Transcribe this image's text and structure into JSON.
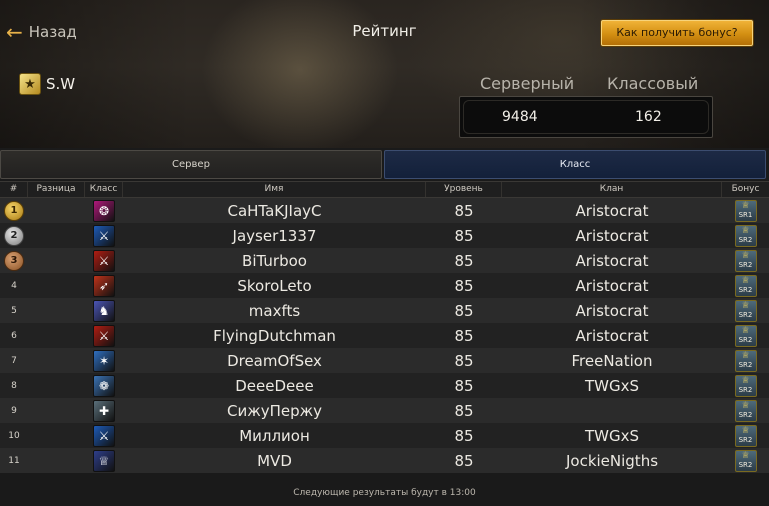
{
  "header": {
    "back_label": "Назад",
    "title": "Рейтинг",
    "bonus_button": "Как получить бонус?"
  },
  "player": {
    "name": "S.W"
  },
  "scores": {
    "server_label": "Серверный",
    "class_label": "Классовый",
    "server_value": "9484",
    "class_value": "162"
  },
  "tabs": {
    "server": "Сервер",
    "class": "Класс",
    "active": "class"
  },
  "table": {
    "headers": {
      "num": "#",
      "diff": "Разница",
      "cls": "Класс",
      "name": "Имя",
      "level": "Уровень",
      "clan": "Клан",
      "bonus": "Бонус"
    },
    "rows": [
      {
        "rank": "1",
        "name": "CaHTaKJIayC",
        "level": "85",
        "clan": "Aristocrat",
        "bonus": "SR1",
        "class_color": "#b0187a",
        "class_icon": "mystic-icon"
      },
      {
        "rank": "2",
        "name": "Jayser1337",
        "level": "85",
        "clan": "Aristocrat",
        "bonus": "SR2",
        "class_color": "#1d5bb8",
        "class_icon": "warrior-blue-icon"
      },
      {
        "rank": "3",
        "name": "BiTurboo",
        "level": "85",
        "clan": "Aristocrat",
        "bonus": "SR2",
        "class_color": "#b11d12",
        "class_icon": "warrior-red-icon"
      },
      {
        "rank": "4",
        "name": "SkoroLeto",
        "level": "85",
        "clan": "Aristocrat",
        "bonus": "SR2",
        "class_color": "#c0331a",
        "class_icon": "archer-icon"
      },
      {
        "rank": "5",
        "name": "maxfts",
        "level": "85",
        "clan": "Aristocrat",
        "bonus": "SR2",
        "class_color": "#4b55b6",
        "class_icon": "knight-icon"
      },
      {
        "rank": "6",
        "name": "FlyingDutchman",
        "level": "85",
        "clan": "Aristocrat",
        "bonus": "SR2",
        "class_color": "#b11d12",
        "class_icon": "warrior-red-icon"
      },
      {
        "rank": "7",
        "name": "DreamOfSex",
        "level": "85",
        "clan": "FreeNation",
        "bonus": "SR2",
        "class_color": "#2f6fc0",
        "class_icon": "rogue-icon"
      },
      {
        "rank": "8",
        "name": "DeeeDeee",
        "level": "85",
        "clan": "TWGxS",
        "bonus": "SR2",
        "class_color": "#3a73b5",
        "class_icon": "summoner-icon"
      },
      {
        "rank": "9",
        "name": "СижуПержу",
        "level": "85",
        "clan": "",
        "bonus": "SR2",
        "class_color": "#5a6f7a",
        "class_icon": "healer-icon"
      },
      {
        "rank": "10",
        "name": "Миллион",
        "level": "85",
        "clan": "TWGxS",
        "bonus": "SR2",
        "class_color": "#1d5bb8",
        "class_icon": "warrior-blue-icon"
      },
      {
        "rank": "11",
        "name": "MVD",
        "level": "85",
        "clan": "JockieNigths",
        "bonus": "SR2",
        "class_color": "#2e3e8a",
        "class_icon": "paladin-icon"
      }
    ]
  },
  "footer": "Следующие результаты будут в 13:00"
}
